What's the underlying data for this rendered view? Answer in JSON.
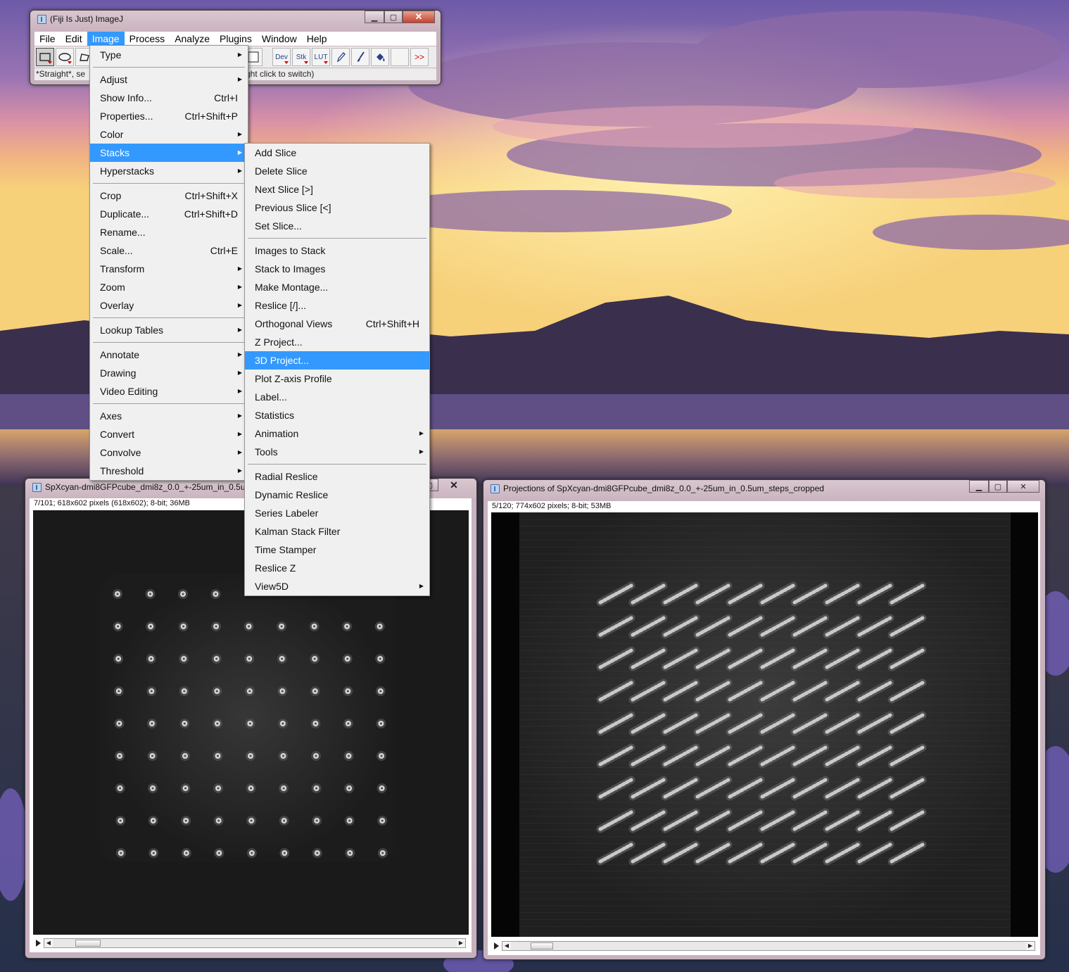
{
  "main_window": {
    "title": "(Fiji Is Just) ImageJ",
    "menubar": [
      "File",
      "Edit",
      "Image",
      "Process",
      "Analyze",
      "Plugins",
      "Window",
      "Help"
    ],
    "active_menu": "Image",
    "tools": {
      "dev": "Dev",
      "stk": "Stk",
      "lut": "LUT",
      "more": ">>"
    },
    "status_left": "*Straight*, se",
    "status_right": "ght click to switch)"
  },
  "image_menu": {
    "items": [
      {
        "label": "Type",
        "submenu": true
      },
      {
        "separator": true
      },
      {
        "label": "Adjust",
        "submenu": true
      },
      {
        "label": "Show Info...",
        "accel": "Ctrl+I"
      },
      {
        "label": "Properties...",
        "accel": "Ctrl+Shift+P"
      },
      {
        "label": "Color",
        "submenu": true
      },
      {
        "label": "Stacks",
        "submenu": true,
        "highlighted": true
      },
      {
        "label": "Hyperstacks",
        "submenu": true
      },
      {
        "separator": true
      },
      {
        "label": "Crop",
        "accel": "Ctrl+Shift+X"
      },
      {
        "label": "Duplicate...",
        "accel": "Ctrl+Shift+D"
      },
      {
        "label": "Rename..."
      },
      {
        "label": "Scale...",
        "accel": "Ctrl+E"
      },
      {
        "label": "Transform",
        "submenu": true
      },
      {
        "label": "Zoom",
        "submenu": true
      },
      {
        "label": "Overlay",
        "submenu": true
      },
      {
        "separator": true
      },
      {
        "label": "Lookup Tables",
        "submenu": true
      },
      {
        "separator": true
      },
      {
        "label": "Annotate",
        "submenu": true
      },
      {
        "label": "Drawing",
        "submenu": true
      },
      {
        "label": "Video Editing",
        "submenu": true
      },
      {
        "separator": true
      },
      {
        "label": "Axes",
        "submenu": true
      },
      {
        "label": "Convert",
        "submenu": true
      },
      {
        "label": "Convolve",
        "submenu": true
      },
      {
        "label": "Threshold",
        "submenu": true
      }
    ]
  },
  "stacks_menu": {
    "items": [
      {
        "label": "Add Slice"
      },
      {
        "label": "Delete Slice"
      },
      {
        "label": "Next Slice [>]"
      },
      {
        "label": "Previous Slice [<]"
      },
      {
        "label": "Set Slice..."
      },
      {
        "separator": true
      },
      {
        "label": "Images to Stack"
      },
      {
        "label": "Stack to Images"
      },
      {
        "label": "Make Montage..."
      },
      {
        "label": "Reslice [/]..."
      },
      {
        "label": "Orthogonal Views",
        "accel": "Ctrl+Shift+H"
      },
      {
        "label": "Z Project..."
      },
      {
        "label": "3D Project...",
        "highlighted": true
      },
      {
        "label": "Plot Z-axis Profile"
      },
      {
        "label": "Label..."
      },
      {
        "label": "Statistics"
      },
      {
        "label": "Animation",
        "submenu": true
      },
      {
        "label": "Tools",
        "submenu": true
      },
      {
        "separator": true
      },
      {
        "label": "Radial Reslice"
      },
      {
        "label": "Dynamic Reslice"
      },
      {
        "label": "Series Labeler"
      },
      {
        "label": "Kalman Stack Filter"
      },
      {
        "label": "Time Stamper"
      },
      {
        "label": "Reslice Z"
      },
      {
        "label": "View5D",
        "submenu": true
      }
    ]
  },
  "left_image_window": {
    "title": "SpXcyan-dmi8GFPcube_dmi8z_0.0_+-25um_in_0.5um",
    "info": "7/101; 618x602 pixels (618x602); 8-bit; 36MB",
    "slice_position": 0.06
  },
  "right_image_window": {
    "title": "Projections of SpXcyan-dmi8GFPcube_dmi8z_0.0_+-25um_in_0.5um_steps_cropped",
    "info": "5/120; 774x602 pixels; 8-bit; 53MB",
    "slice_position": 0.04
  },
  "icons": {
    "minimize": "minimize-icon",
    "maximize": "maximize-icon",
    "close": "close-icon",
    "submenu_arrow": "submenu-arrow-icon"
  },
  "colors": {
    "menu_highlight": "#3399ff",
    "menu_background": "#f0f0f0",
    "window_frame": "#c9b3bf"
  }
}
